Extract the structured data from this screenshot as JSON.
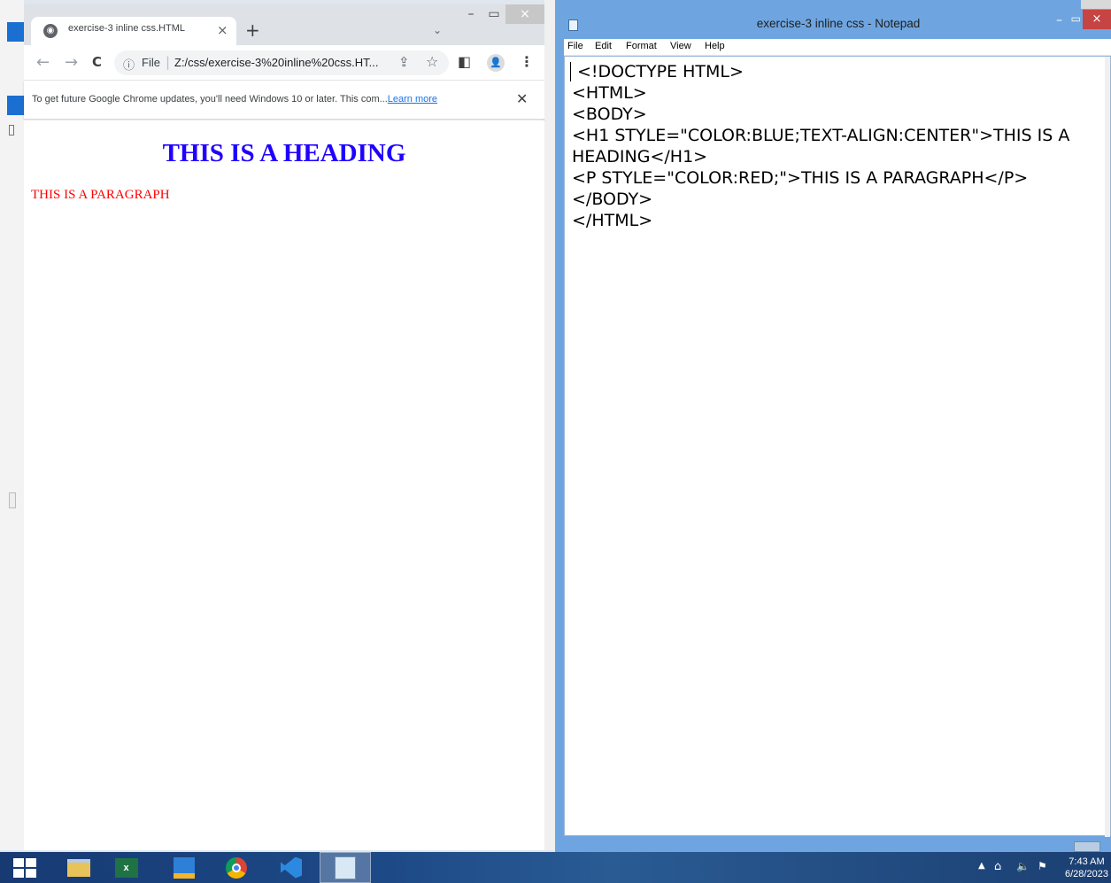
{
  "chrome": {
    "tab_title": "exercise-3 inline css.HTML",
    "tab_close": "×",
    "new_tab": "+",
    "tab_search": "⌄",
    "win_min": "–",
    "win_max": "▭",
    "win_close": "×",
    "nav_back": "←",
    "nav_forward": "→",
    "nav_reload": "C",
    "omnibox_info": "ⓘ",
    "omnibox_scheme": "File",
    "omnibox_sep": "|",
    "omnibox_url": "Z:/css/exercise-3%20inline%20css.HT...",
    "share_icon": "⇪",
    "star_icon": "☆",
    "side_panel_icon": "◧",
    "profile_icon": "👤",
    "menu_icon": "⋮",
    "infobar_text": "To get future Google Chrome updates, you'll need Windows 10 or later. This com...",
    "infobar_link": "Learn more",
    "infobar_close": "✕"
  },
  "page": {
    "heading": "THIS IS A HEADING",
    "paragraph": "THIS IS A PARAGRAPH",
    "heading_color": "#1f00ff",
    "paragraph_color": "#ff0000"
  },
  "notepad": {
    "title": "exercise-3 inline css - Notepad",
    "menu": [
      "File",
      "Edit",
      "Format",
      "View",
      "Help"
    ],
    "lines": [
      "<!DOCTYPE HTML>",
      "<HTML>",
      "<BODY>",
      "<H1 STYLE=\"COLOR:BLUE;TEXT-ALIGN:CENTER\">THIS IS A",
      "HEADING</H1>",
      "<P STYLE=\"COLOR:RED;\">THIS IS A PARAGRAPH</P>",
      "</BODY>",
      "</HTML>"
    ],
    "min": "–",
    "max": "▭",
    "close": "×"
  },
  "taskbar": {
    "excel_label": "x",
    "time": "7:43 AM",
    "date": "6/28/2023"
  }
}
